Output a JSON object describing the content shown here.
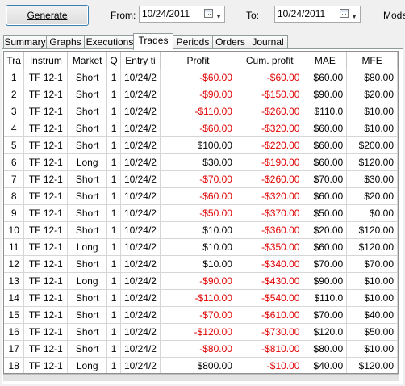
{
  "toolbar": {
    "generate_label": "Generate",
    "from_label": "From:",
    "from_date": "10/24/2011",
    "to_label": "To:",
    "to_date": "10/24/2011",
    "mode_label": "Mode"
  },
  "tabs": [
    "Summary",
    "Graphs",
    "Executions",
    "Trades",
    "Periods",
    "Orders",
    "Journal"
  ],
  "active_tab": "Trades",
  "table": {
    "columns": [
      "Tra",
      "Instrum",
      "Market",
      "Q",
      "Entry ti",
      "Profit",
      "Cum. profit",
      "MAE",
      "MFE"
    ],
    "rows": [
      [
        "1",
        "TF 12-1",
        "Short",
        "1",
        "10/24/2",
        "-$60.00",
        "-$60.00",
        "$60.00",
        "$80.00"
      ],
      [
        "2",
        "TF 12-1",
        "Short",
        "1",
        "10/24/2",
        "-$90.00",
        "-$150.00",
        "$90.00",
        "$20.00"
      ],
      [
        "3",
        "TF 12-1",
        "Short",
        "1",
        "10/24/2",
        "-$110.00",
        "-$260.00",
        "$110.0",
        "$10.00"
      ],
      [
        "4",
        "TF 12-1",
        "Short",
        "1",
        "10/24/2",
        "-$60.00",
        "-$320.00",
        "$60.00",
        "$10.00"
      ],
      [
        "5",
        "TF 12-1",
        "Short",
        "1",
        "10/24/2",
        "$100.00",
        "-$220.00",
        "$60.00",
        "$200.00"
      ],
      [
        "6",
        "TF 12-1",
        "Long",
        "1",
        "10/24/2",
        "$30.00",
        "-$190.00",
        "$60.00",
        "$120.00"
      ],
      [
        "7",
        "TF 12-1",
        "Short",
        "1",
        "10/24/2",
        "-$70.00",
        "-$260.00",
        "$70.00",
        "$30.00"
      ],
      [
        "8",
        "TF 12-1",
        "Short",
        "1",
        "10/24/2",
        "-$60.00",
        "-$320.00",
        "$60.00",
        "$20.00"
      ],
      [
        "9",
        "TF 12-1",
        "Short",
        "1",
        "10/24/2",
        "-$50.00",
        "-$370.00",
        "$50.00",
        "$0.00"
      ],
      [
        "10",
        "TF 12-1",
        "Short",
        "1",
        "10/24/2",
        "$10.00",
        "-$360.00",
        "$20.00",
        "$120.00"
      ],
      [
        "11",
        "TF 12-1",
        "Long",
        "1",
        "10/24/2",
        "$10.00",
        "-$350.00",
        "$60.00",
        "$120.00"
      ],
      [
        "12",
        "TF 12-1",
        "Short",
        "1",
        "10/24/2",
        "$10.00",
        "-$340.00",
        "$70.00",
        "$70.00"
      ],
      [
        "13",
        "TF 12-1",
        "Long",
        "1",
        "10/24/2",
        "-$90.00",
        "-$430.00",
        "$90.00",
        "$10.00"
      ],
      [
        "14",
        "TF 12-1",
        "Short",
        "1",
        "10/24/2",
        "-$110.00",
        "-$540.00",
        "$110.0",
        "$10.00"
      ],
      [
        "15",
        "TF 12-1",
        "Short",
        "1",
        "10/24/2",
        "-$70.00",
        "-$610.00",
        "$70.00",
        "$40.00"
      ],
      [
        "16",
        "TF 12-1",
        "Short",
        "1",
        "10/24/2",
        "-$120.00",
        "-$730.00",
        "$120.0",
        "$50.00"
      ],
      [
        "17",
        "TF 12-1",
        "Short",
        "1",
        "10/24/2",
        "-$80.00",
        "-$810.00",
        "$80.00",
        "$10.00"
      ],
      [
        "18",
        "TF 12-1",
        "Long",
        "1",
        "10/24/2",
        "$800.00",
        "-$10.00",
        "$40.00",
        "$120.00"
      ]
    ]
  },
  "colors": {
    "negative": "#e00000",
    "button_border": "#3c7fb1"
  },
  "icons": {
    "date_picker": "calendar-icon",
    "dropdown": "chevron-down-icon"
  }
}
